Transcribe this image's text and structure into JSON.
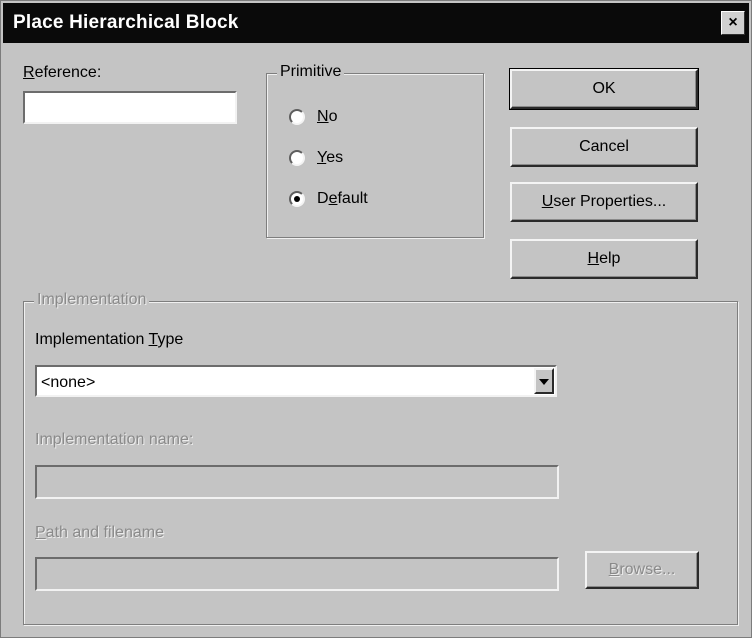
{
  "window": {
    "title": "Place Hierarchical Block",
    "close_glyph": "×"
  },
  "reference": {
    "label": "Reference:",
    "value": ""
  },
  "primitive": {
    "legend": "Primitive",
    "options": [
      {
        "label": "No",
        "checked": false
      },
      {
        "label": "Yes",
        "checked": false
      },
      {
        "label": "Default",
        "checked": true
      }
    ]
  },
  "buttons": {
    "ok": "OK",
    "cancel": "Cancel",
    "user_properties": "User Properties...",
    "help": "Help"
  },
  "implementation": {
    "legend": "Implementation",
    "type_label": "Implementation Type",
    "type_value": "<none>",
    "name_label": "Implementation name:",
    "name_value": "",
    "path_label": "Path and filename",
    "path_value": "",
    "browse": "Browse..."
  },
  "colors": {
    "titlebar": "#0a0a0a",
    "dialog_face": "#c4c4c4",
    "disabled_text": "#8a8a8a"
  }
}
